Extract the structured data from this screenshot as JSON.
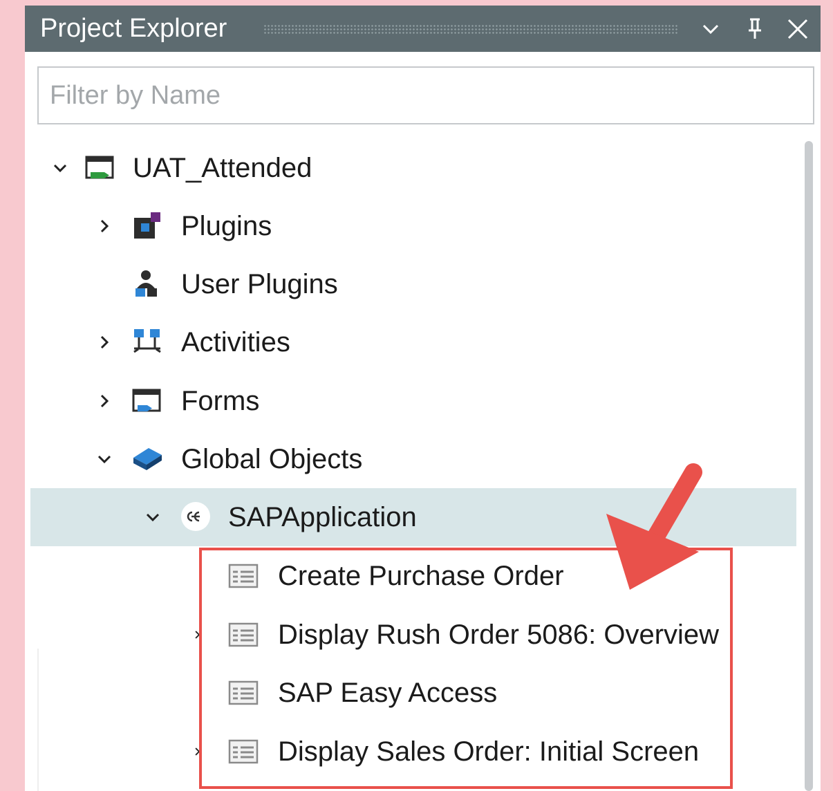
{
  "panel": {
    "title": "Project Explorer",
    "buttons": {
      "dropdown_icon": "chevron-down-icon",
      "pin_icon": "pin-icon",
      "close_icon": "close-icon"
    }
  },
  "filter": {
    "placeholder": "Filter by Name",
    "value": ""
  },
  "tree": {
    "root": {
      "label": "UAT_Attended",
      "icon": "project-icon",
      "expanded": true
    },
    "plugins": {
      "label": "Plugins",
      "icon": "plugins-icon",
      "expanded": false
    },
    "user_plugins": {
      "label": "User Plugins",
      "icon": "user-plugins-icon"
    },
    "activities": {
      "label": "Activities",
      "icon": "activities-icon",
      "expanded": false
    },
    "forms": {
      "label": "Forms",
      "icon": "forms-icon",
      "expanded": false
    },
    "global_objects": {
      "label": "Global Objects",
      "icon": "global-objects-icon",
      "expanded": true
    },
    "sap_application": {
      "label": "SAPApplication",
      "icon": "sap-application-icon",
      "expanded": true,
      "selected": true
    },
    "screens": [
      {
        "label": "Create Purchase Order",
        "icon": "screen-icon",
        "has_children": false
      },
      {
        "label": "Display Rush Order 5086: Overview",
        "icon": "screen-icon",
        "has_children": true
      },
      {
        "label": "SAP Easy Access",
        "icon": "screen-icon",
        "has_children": false
      },
      {
        "label": "Display Sales Order: Initial Screen",
        "icon": "screen-icon",
        "has_children": true
      }
    ]
  },
  "colors": {
    "titlebar": "#5d6b70",
    "selection": "#d8e6e8",
    "highlight": "#e9514b",
    "background": "#f8c9cf"
  },
  "annotation": {
    "type": "highlight-box-with-arrow"
  }
}
